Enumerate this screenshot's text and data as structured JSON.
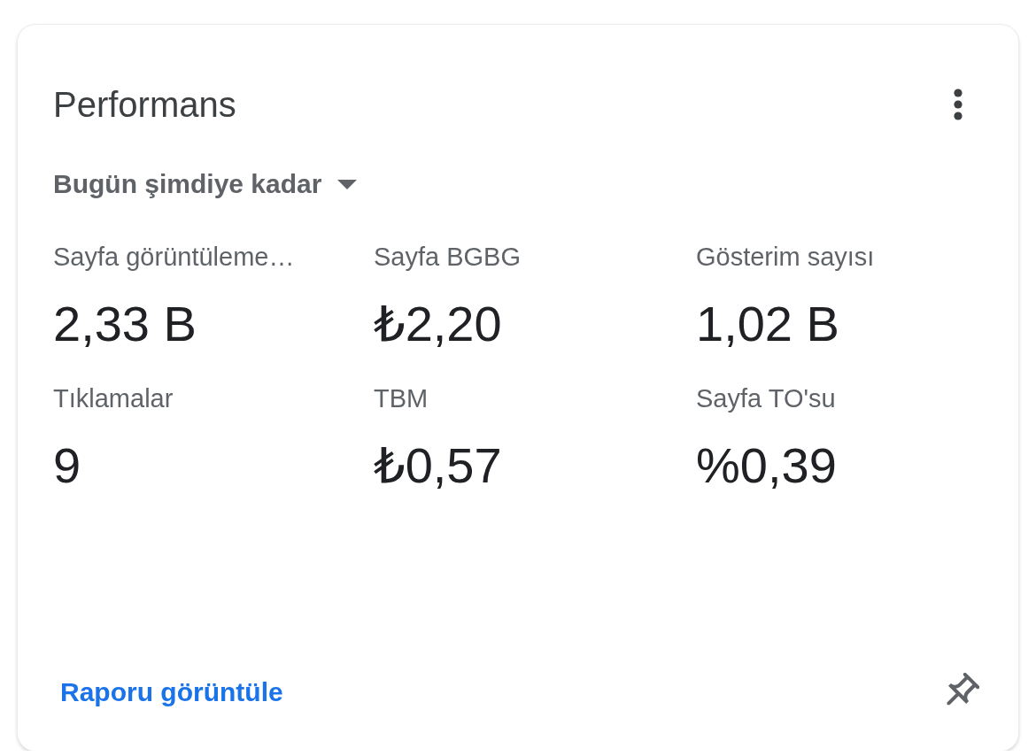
{
  "card": {
    "title": "Performans",
    "period_dropdown": {
      "value": "Bugün şimdiye kadar"
    },
    "metrics": [
      {
        "label": "Sayfa görüntüleme…",
        "value": "2,33 B"
      },
      {
        "label": "Sayfa BGBG",
        "value": "₺2,20"
      },
      {
        "label": "Gösterim sayısı",
        "value": "1,02 B"
      },
      {
        "label": "Tıklamalar",
        "value": "9"
      },
      {
        "label": "TBM",
        "value": "₺0,57"
      },
      {
        "label": "Sayfa TO'su",
        "value": "%0,39"
      }
    ],
    "footer": {
      "link": "Raporu görüntüle"
    }
  }
}
